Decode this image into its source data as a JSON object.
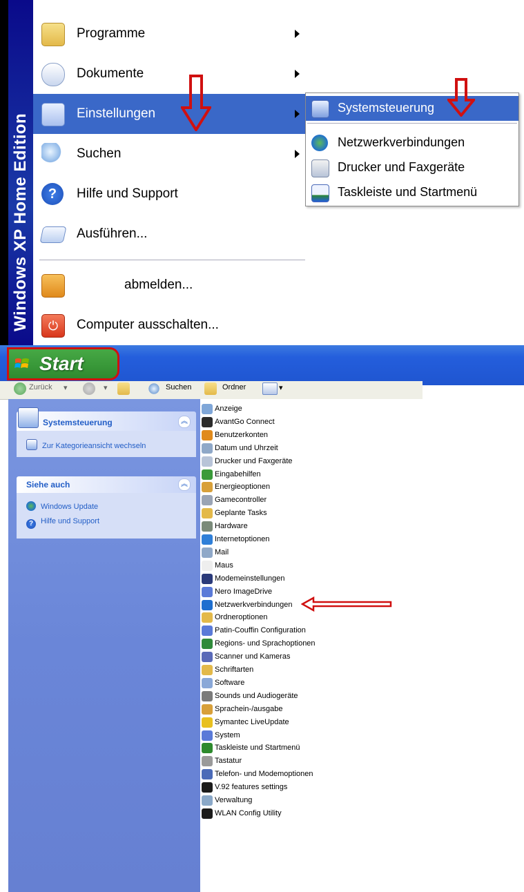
{
  "start_menu": {
    "sidebar_text": "Windows XP Home Edition",
    "items": [
      {
        "label": "Programme",
        "icon": "programs-folder-icon",
        "has_submenu": true,
        "highlighted": false
      },
      {
        "label": "Dokumente",
        "icon": "documents-icon",
        "has_submenu": true,
        "highlighted": false
      },
      {
        "label": "Einstellungen",
        "icon": "settings-icon",
        "has_submenu": true,
        "highlighted": true
      },
      {
        "label": "Suchen",
        "icon": "search-icon",
        "has_submenu": true,
        "highlighted": false
      },
      {
        "label": "Hilfe und Support",
        "icon": "help-icon",
        "has_submenu": false,
        "highlighted": false
      },
      {
        "label": "Ausführen...",
        "icon": "run-icon",
        "has_submenu": false,
        "highlighted": false
      },
      {
        "label": "abmelden...",
        "icon": "logoff-key-icon",
        "has_submenu": false,
        "highlighted": false
      },
      {
        "label": "Computer ausschalten...",
        "icon": "power-icon",
        "has_submenu": false,
        "highlighted": false
      }
    ],
    "submenu": [
      {
        "label": "Systemsteuerung",
        "icon": "control-panel-icon",
        "highlighted": true
      },
      {
        "label": "Netzwerkverbindungen",
        "icon": "network-icon",
        "highlighted": false
      },
      {
        "label": "Drucker und Faxgeräte",
        "icon": "printer-icon",
        "highlighted": false
      },
      {
        "label": "Taskleiste und Startmenü",
        "icon": "taskbar-icon",
        "highlighted": false
      }
    ],
    "start_label": "Start"
  },
  "toolbar": {
    "back_label": "Zurück",
    "search_label": "Suchen",
    "folders_label": "Ordner"
  },
  "control_panel": {
    "task_box": {
      "title": "Systemsteuerung",
      "link": "Zur Kategorieansicht wechseln"
    },
    "see_also_box": {
      "title": "Siehe auch",
      "links": [
        "Windows Update",
        "Hilfe und Support"
      ]
    },
    "items": [
      "Anzeige",
      "AvantGo Connect",
      "Benutzerkonten",
      "Datum und Uhrzeit",
      "Drucker und Faxgeräte",
      "Eingabehilfen",
      "Energieoptionen",
      "Gamecontroller",
      "Geplante Tasks",
      "Hardware",
      "Internetoptionen",
      "Mail",
      "Maus",
      "Modemeinstellungen",
      "Nero ImageDrive",
      "Netzwerkverbindungen",
      "Ordneroptionen",
      "Patin-Couffin Configuration",
      "Regions- und Sprachoptionen",
      "Scanner und Kameras",
      "Schriftarten",
      "Software",
      "Sounds und Audiogeräte",
      "Sprachein-/ausgabe",
      "Symantec LiveUpdate",
      "System",
      "Taskleiste und Startmenü",
      "Tastatur",
      "Telefon- und Modemoptionen",
      "V.92 features settings",
      "Verwaltung",
      "WLAN Config Utility"
    ],
    "highlighted_item": "Netzwerkverbindungen"
  },
  "colors": {
    "menu_highlight": "#3a68c8",
    "taskbar": "#245edc",
    "start_button": "#3a9a3a",
    "annotation_red": "#d01010",
    "sidebar_blue": "#6a86d8"
  }
}
